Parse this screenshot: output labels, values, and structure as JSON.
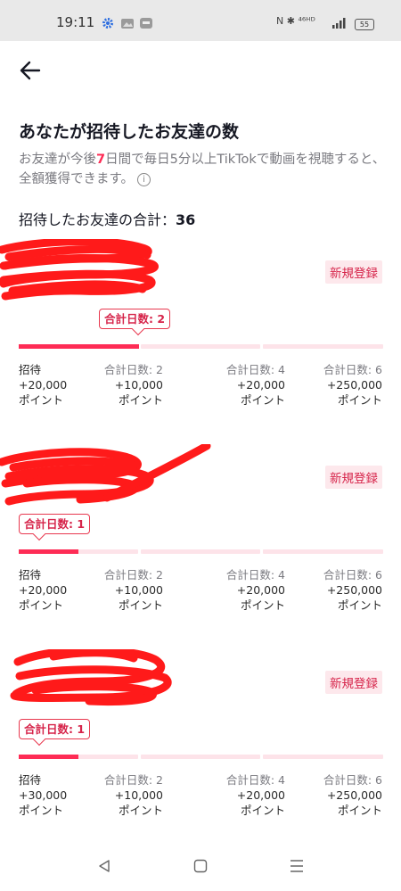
{
  "status_bar": {
    "time": "19:11",
    "battery": "55",
    "signal_text": "N ✱ ⁴⁶ᴴᴰ"
  },
  "header": {
    "back_icon": "arrow-left-icon"
  },
  "page": {
    "title": "あなたが招待したお友達の数",
    "desc_before": "お友達が今後",
    "desc_highlight": "7",
    "desc_after": "日間で毎日5分以上TikTokで動画を視聴すると、全額獲得できます。",
    "info_icon": "i",
    "total_label": "招待したお友達の合計：",
    "total_value": "36"
  },
  "friends": [
    {
      "badge": "新規登録",
      "tooltip": "合計日数: 2",
      "progress": 0.33,
      "milestones": [
        {
          "label": "招待",
          "points": "+20,000",
          "unit": "ポイント"
        },
        {
          "label": "合計日数: 2",
          "points": "+10,000",
          "unit": "ポイント"
        },
        {
          "label": "合計日数: 4",
          "points": "+20,000",
          "unit": "ポイント"
        },
        {
          "label": "合計日数: 6",
          "points": "+250,000",
          "unit": "ポイント"
        }
      ]
    },
    {
      "badge": "新規登録",
      "tooltip": "合計日数: 1",
      "progress": 0.165,
      "milestones": [
        {
          "label": "招待",
          "points": "+20,000",
          "unit": "ポイント"
        },
        {
          "label": "合計日数: 2",
          "points": "+10,000",
          "unit": "ポイント"
        },
        {
          "label": "合計日数: 4",
          "points": "+20,000",
          "unit": "ポイント"
        },
        {
          "label": "合計日数: 6",
          "points": "+250,000",
          "unit": "ポイント"
        }
      ]
    },
    {
      "badge": "新規登録",
      "tooltip": "合計日数: 1",
      "progress": 0.165,
      "milestones": [
        {
          "label": "招待",
          "points": "+30,000",
          "unit": "ポイント"
        },
        {
          "label": "合計日数: 2",
          "points": "+10,000",
          "unit": "ポイント"
        },
        {
          "label": "合計日数: 4",
          "points": "+20,000",
          "unit": "ポイント"
        },
        {
          "label": "合計日数: 6",
          "points": "+250,000",
          "unit": "ポイント"
        }
      ]
    }
  ],
  "colors": {
    "accent": "#fe2c55",
    "track": "#fde3e9",
    "redaction": "#ff1a1a"
  },
  "nav_bar": {
    "back_icon": "triangle-back-icon",
    "home_icon": "square-home-icon",
    "menu_icon": "menu-lines-icon"
  }
}
